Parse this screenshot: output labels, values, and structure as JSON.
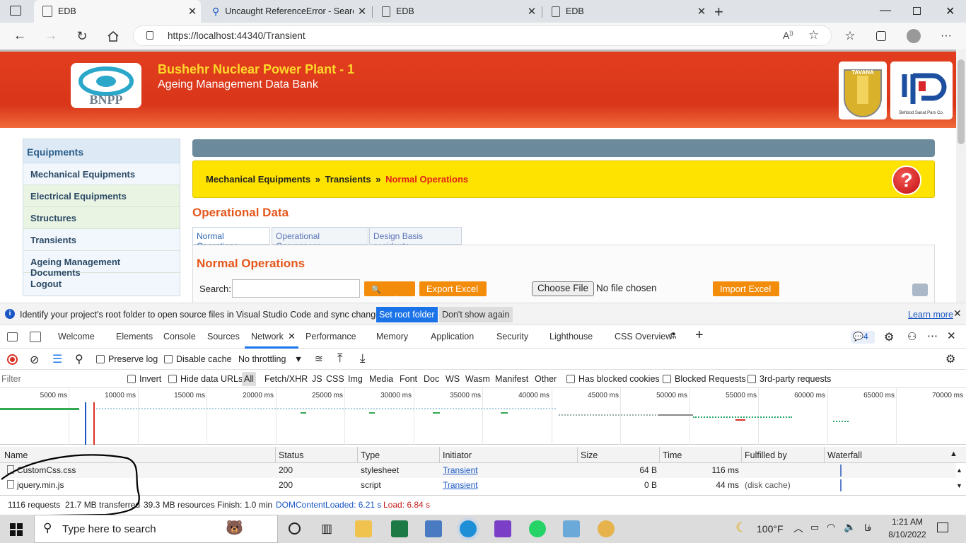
{
  "browser": {
    "tabs": [
      {
        "title": "EDB",
        "active": true
      },
      {
        "title": "Uncaught ReferenceError - Searc",
        "active": false
      },
      {
        "title": "EDB",
        "active": false
      },
      {
        "title": "EDB",
        "active": false
      }
    ],
    "url": "https://localhost:44340/Transient"
  },
  "site": {
    "title": "Bushehr Nuclear Power Plant - 1",
    "subtitle": "Ageing Management Data Bank",
    "logo_text": "BNPP",
    "partner_logo_1": "TAVANA",
    "partner_logo_2": "Behbod Sanat Pars Co."
  },
  "sidebar": {
    "header": "Equipments",
    "items": [
      {
        "label": "Mechanical Equipments"
      },
      {
        "label": "Electrical Equipments"
      },
      {
        "label": "Structures"
      },
      {
        "label": "Transients"
      },
      {
        "label": "Ageing Management Documents"
      },
      {
        "label": "Logout"
      }
    ]
  },
  "breadcrumb": {
    "part1": "Mechanical Equipments",
    "sep": "»",
    "part2": "Transients",
    "part3": "Normal Operations",
    "help": "?"
  },
  "main": {
    "section_title": "Operational Data",
    "tabs": [
      {
        "label": "Normal Operations"
      },
      {
        "label": "Operational Occurances"
      },
      {
        "label": "Design Basis accidents"
      }
    ],
    "panel_title": "Normal Operations",
    "search_label": "Search:",
    "search_value": "",
    "search_button": "Search",
    "export_button": "Export Excel",
    "choose_file": "Choose File",
    "no_file": "No file chosen",
    "import_button": "Import Excel"
  },
  "infobar": {
    "message": "Identify your project's root folder to open source files in Visual Studio Code and sync changes.",
    "set_root": "Set root folder",
    "dont_show": "Don't show again",
    "learn_more": "Learn more"
  },
  "devtools": {
    "tabs": [
      "Welcome",
      "Elements",
      "Console",
      "Sources",
      "Network",
      "Performance",
      "Memory",
      "Application",
      "Security",
      "Lighthouse",
      "CSS Overview"
    ],
    "active_tab": "Network",
    "issues_count": "4",
    "preserve_log": "Preserve log",
    "disable_cache": "Disable cache",
    "throttling": "No throttling",
    "filter_placeholder": "Filter",
    "invert": "Invert",
    "hide_data_urls": "Hide data URLs",
    "types": [
      "All",
      "Fetch/XHR",
      "JS",
      "CSS",
      "Img",
      "Media",
      "Font",
      "Doc",
      "WS",
      "Wasm",
      "Manifest",
      "Other"
    ],
    "has_blocked_cookies": "Has blocked cookies",
    "blocked_requests": "Blocked Requests",
    "third_party": "3rd-party requests",
    "timeline_ticks": [
      "5000 ms",
      "10000 ms",
      "15000 ms",
      "20000 ms",
      "25000 ms",
      "30000 ms",
      "35000 ms",
      "40000 ms",
      "45000 ms",
      "50000 ms",
      "55000 ms",
      "60000 ms",
      "65000 ms",
      "70000 ms"
    ],
    "columns": [
      "Name",
      "Status",
      "Type",
      "Initiator",
      "Size",
      "Time",
      "Fulfilled by",
      "Waterfall"
    ],
    "rows": [
      {
        "name": "CustomCss.css",
        "status": "200",
        "type": "stylesheet",
        "initiator": "Transient",
        "size": "64 B",
        "time": "116 ms",
        "fulfilled": ""
      },
      {
        "name": "jquery.min.js",
        "status": "200",
        "type": "script",
        "initiator": "Transient",
        "size": "0 B",
        "time": "44 ms",
        "fulfilled": "(disk cache)"
      }
    ],
    "summary": {
      "requests": "1116 requests",
      "transferred": "21.7 MB transferred",
      "resources": "39.3 MB resources",
      "finish": "Finish: 1.0 min",
      "dcl": "DOMContentLoaded: 6.21 s",
      "load": "Load: 6.84 s"
    }
  },
  "taskbar": {
    "search_placeholder": "Type here to search",
    "weather": "100°F",
    "lang": "فا",
    "time": "1:21 AM",
    "date": "8/10/2022"
  },
  "colors": {
    "banner": "#e23d1e",
    "banner_title": "#ffd82a",
    "accent_orange": "#f38c0b",
    "section_title": "#e4571b",
    "breadcrumb_bg": "#ffe300",
    "devtools_active": "#1a73e8"
  }
}
